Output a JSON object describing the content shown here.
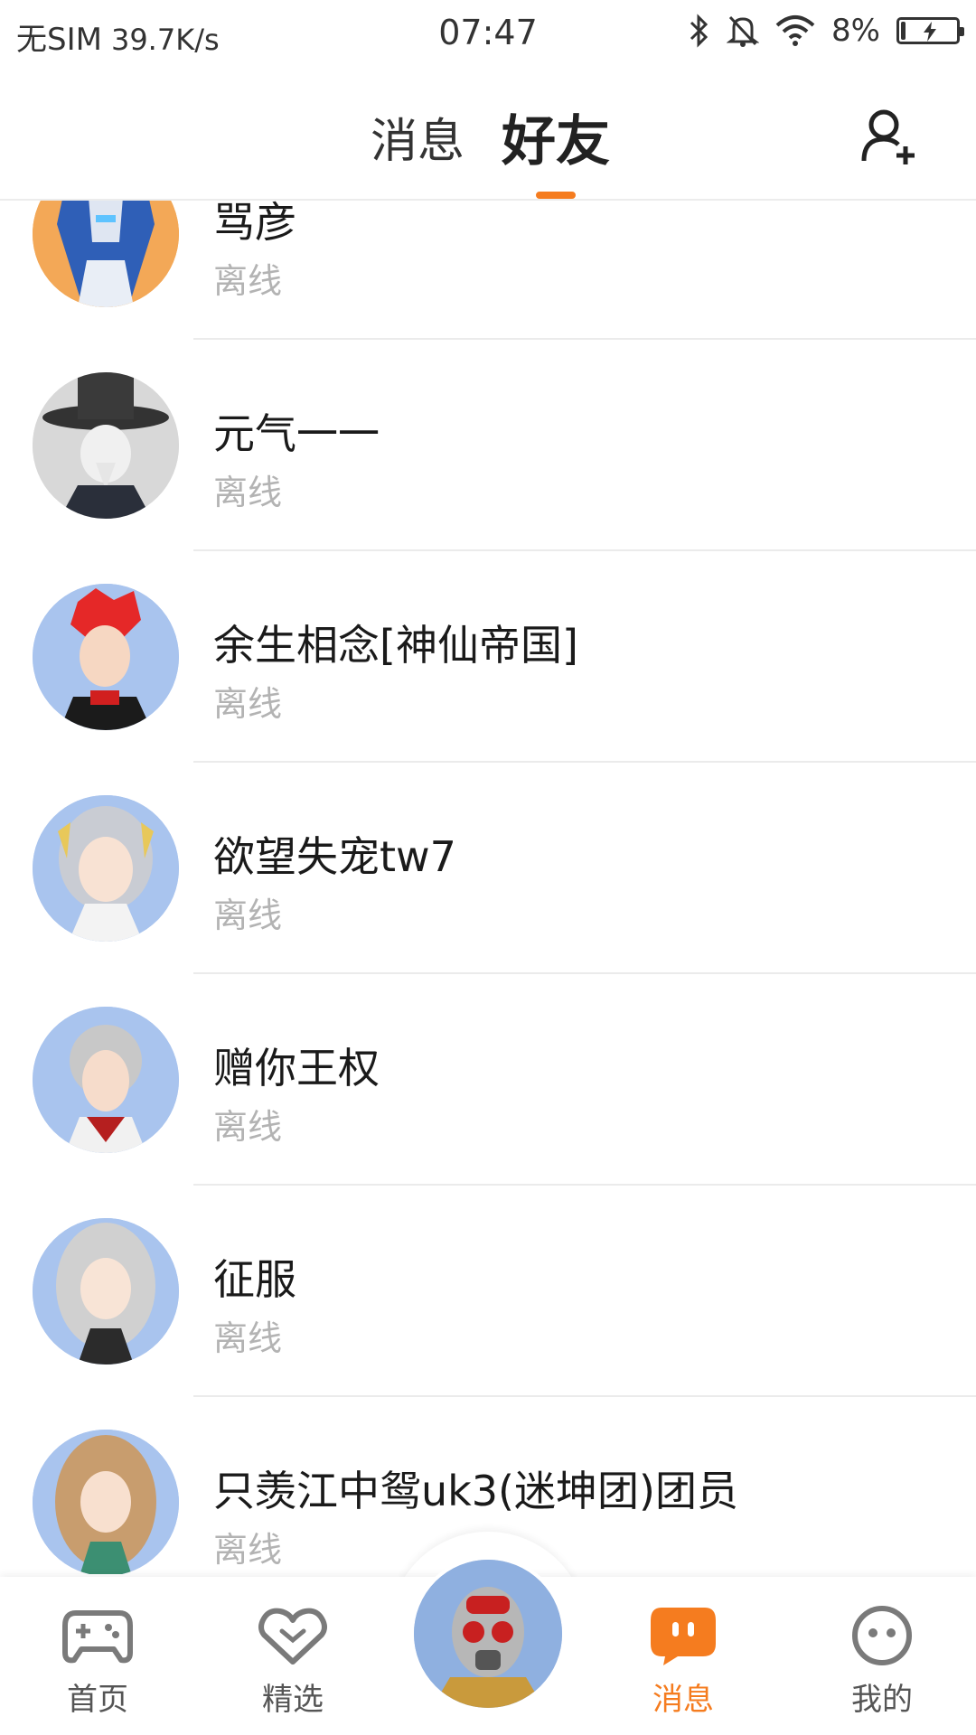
{
  "status_bar": {
    "carrier": "无SIM",
    "speed": "39.7K/s",
    "time": "07:47",
    "battery": "8%",
    "battery_level": 0.08,
    "icons": [
      "bluetooth-icon",
      "mute-icon",
      "wifi-icon",
      "battery-charging-icon"
    ]
  },
  "header": {
    "tabs": [
      {
        "label": "消息",
        "active": false
      },
      {
        "label": "好友",
        "active": true
      }
    ],
    "accent_color": "#f57c1f",
    "action_icon": "add-friend-icon"
  },
  "friends": [
    {
      "name": "骂彦",
      "status": "离线"
    },
    {
      "name": "元气一一",
      "status": "离线"
    },
    {
      "name": "余生相念[神仙帝国]",
      "status": "离线"
    },
    {
      "name": "欲望失宠tw7",
      "status": "离线"
    },
    {
      "name": "赠你王权",
      "status": "离线"
    },
    {
      "name": "征服",
      "status": "离线"
    },
    {
      "name": "只羡江中鸳uk3(迷坤团)团员",
      "status": "离线"
    }
  ],
  "bottom_nav": {
    "items": [
      {
        "label": "首页",
        "icon": "gamepad-icon",
        "active": false
      },
      {
        "label": "精选",
        "icon": "heart-icon",
        "active": false
      },
      {
        "label": "消息",
        "icon": "chat-icon",
        "active": true
      },
      {
        "label": "我的",
        "icon": "smiley-face-icon",
        "active": false
      }
    ],
    "center_icon": "profile-avatar"
  }
}
